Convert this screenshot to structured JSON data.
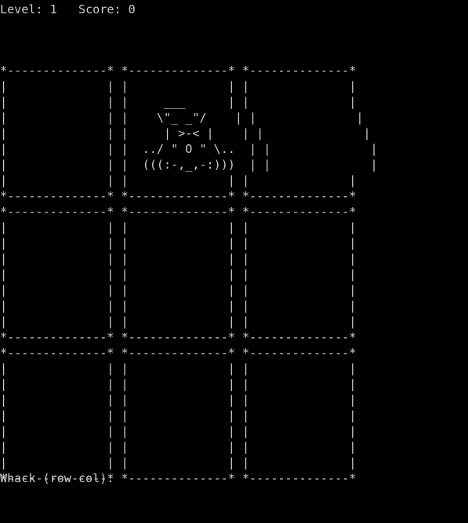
{
  "window": {
    "background": "#000000",
    "foreground": "#cccccc"
  },
  "status": {
    "level_label": "Level:",
    "level_value": "1",
    "score_label": "Score:",
    "score_value": "0"
  },
  "board": {
    "rows": 3,
    "cols": 3,
    "mole_position": {
      "row": 0,
      "col": 1
    },
    "rows_text": [
      "*--------------* *--------------* *--------------*\n|              | |              | |              |\n|              | |     ___      | |              |\n|              | |    \\\"_ _\"/    | |              |\n|              | |     | >-< |    | |              |\n|              | |  ../ \" O \" \\..  | |              |\n|              | |  (((:-,_,-:)))  | |              |\n|              | |              | |              |\n*--------------* *--------------* *--------------*",
      "*--------------* *--------------* *--------------*\n|              | |              | |              |\n|              | |              | |              |\n|              | |              | |              |\n|              | |              | |              |\n|              | |              | |              |\n|              | |              | |              |\n|              | |              | |              |\n*--------------* *--------------* *--------------*",
      "*--------------* *--------------* *--------------*\n|              | |              | |              |\n|              | |              | |              |\n|              | |              | |              |\n|              | |              | |              |\n|              | |              | |              |\n|              | |              | |              |\n|              | |              | |              |\n*--------------* *--------------* *--------------*"
    ]
  },
  "prompt": {
    "text": "Whack (row col):"
  }
}
